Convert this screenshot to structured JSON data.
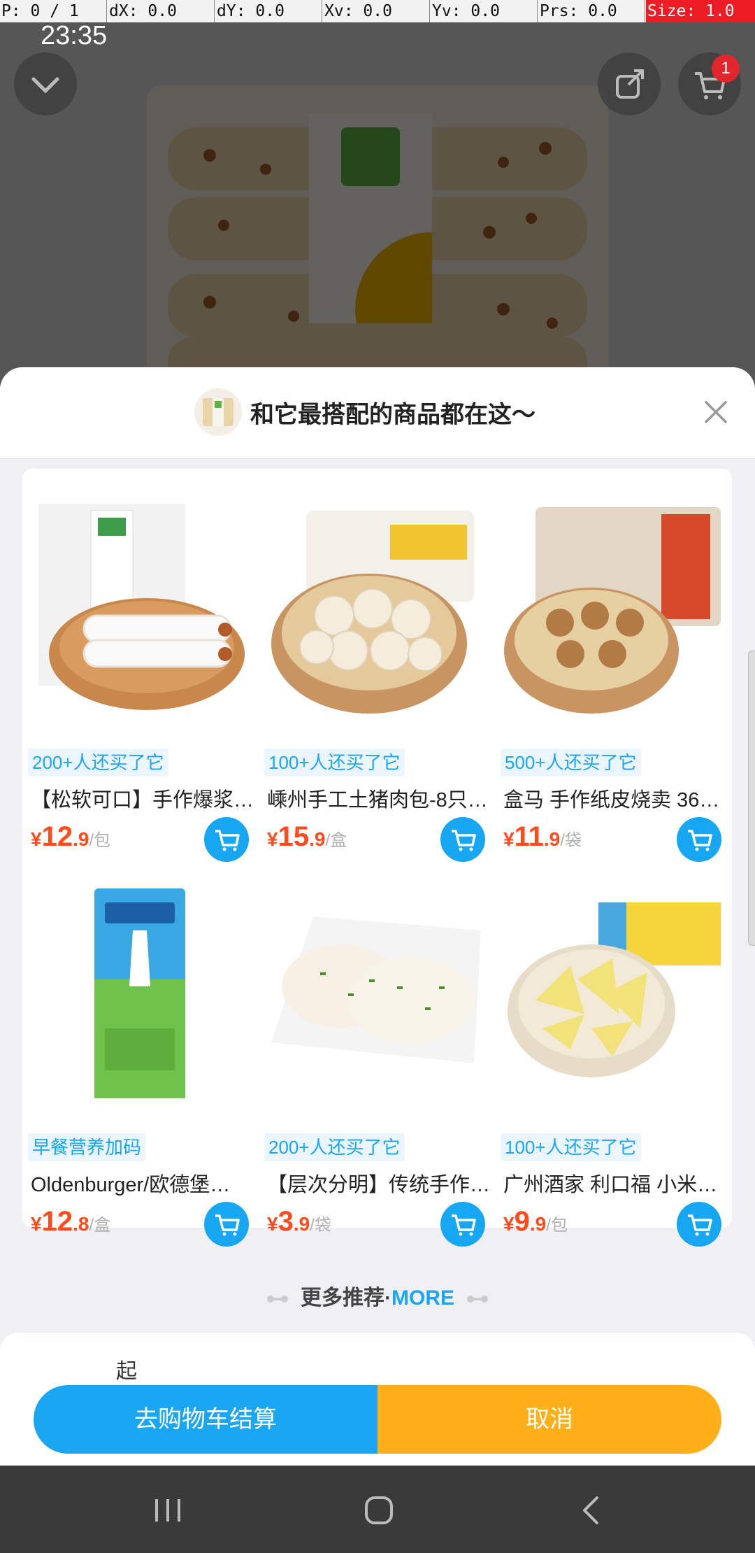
{
  "debug_bar": {
    "p": "P: 0 / 1",
    "dx": "dX: 0.0",
    "dy": "dY: 0.0",
    "xv": "Xv: 0.0",
    "yv": "Yv: 0.0",
    "prs": "Prs: 0.0",
    "size": "Size: 1.0"
  },
  "status_bar": {
    "time": "23:35"
  },
  "top_actions": {
    "cart_badge": "1"
  },
  "sheet": {
    "title": "和它最搭配的商品都在这～",
    "products": [
      {
        "tag": "200+人还买了它",
        "name": "【松软可口】手作爆浆…",
        "price_int": "12",
        "price_dec": ".9",
        "unit": "/包",
        "currency": "¥"
      },
      {
        "tag": "100+人还买了它",
        "name": "嵊州手工土猪肉包-8只…",
        "price_int": "15",
        "price_dec": ".9",
        "unit": "/盒",
        "currency": "¥"
      },
      {
        "tag": "500+人还买了它",
        "name": "盒马 手作纸皮烧卖 36…",
        "price_int": "11",
        "price_dec": ".9",
        "unit": "/袋",
        "currency": "¥"
      },
      {
        "tag": "早餐营养加码",
        "name": "Oldenburger/欧德堡…",
        "price_int": "12",
        "price_dec": ".8",
        "unit": "/盒",
        "currency": "¥"
      },
      {
        "tag": "200+人还买了它",
        "name": "【层次分明】传统手作…",
        "price_int": "3",
        "price_dec": ".9",
        "unit": "/袋",
        "currency": "¥"
      },
      {
        "tag": "100+人还买了它",
        "name": "广州酒家 利口福 小米…",
        "price_int": "9",
        "price_dec": ".9",
        "unit": "/包",
        "currency": "¥"
      }
    ],
    "more_cn": "更多推荐·",
    "more_en": "MORE",
    "lower_partial": "起"
  },
  "buttons": {
    "checkout": "去购物车结算",
    "cancel": "取消"
  },
  "colors": {
    "accent_blue": "#1ba6f2",
    "accent_orange": "#ffb019",
    "price_red": "#ff4a1c"
  }
}
